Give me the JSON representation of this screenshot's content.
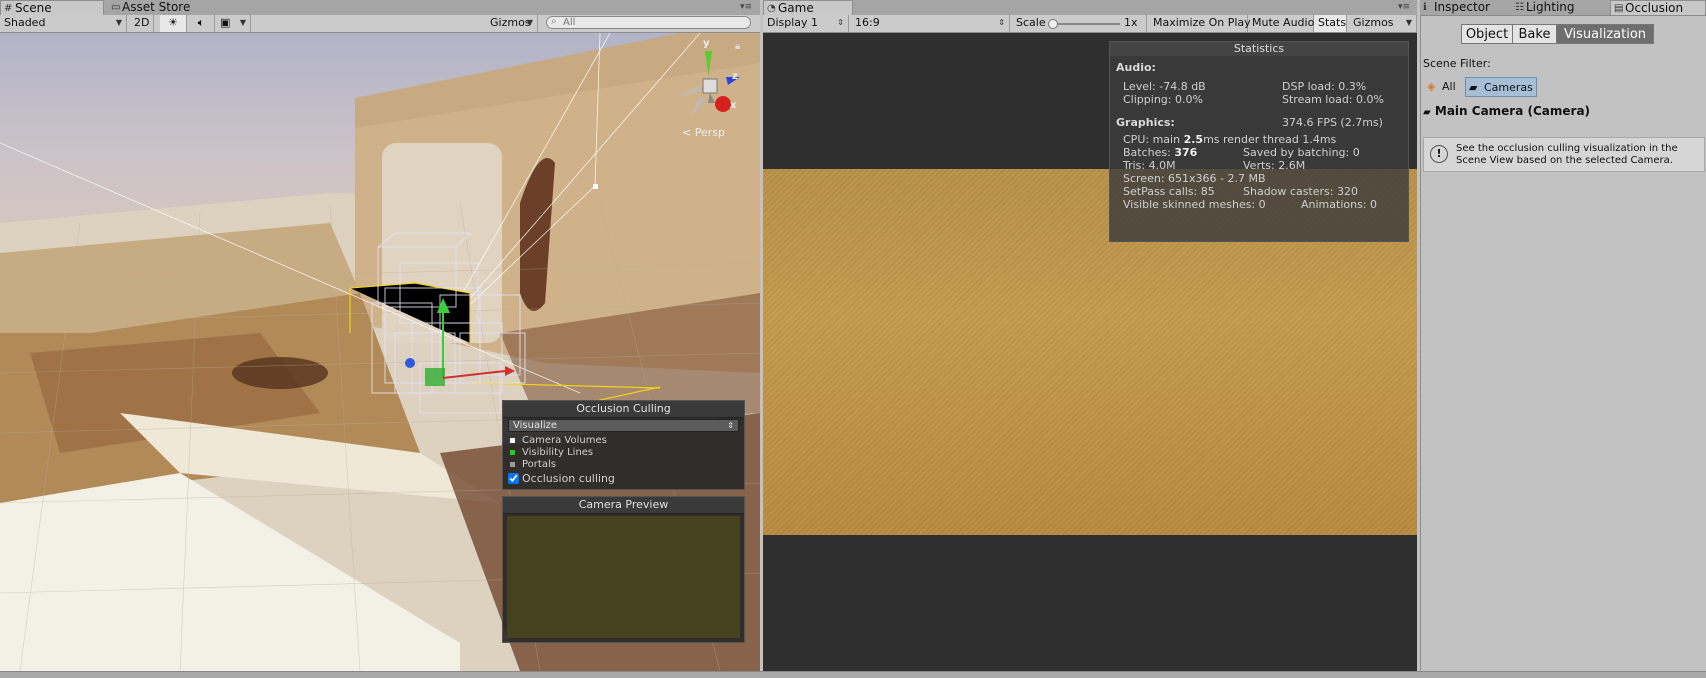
{
  "scene_tabs": {
    "scene": "Scene",
    "asset_store": "Asset Store"
  },
  "scene_toolbar": {
    "draw_mode": "Shaded",
    "mode_2d": "2D",
    "gizmos": "Gizmos",
    "search_placeholder": "All"
  },
  "scene_view": {
    "axis_y": "y",
    "axis_z": "z",
    "axis_x": "x",
    "projection": "Persp",
    "occlusion_panel": {
      "title": "Occlusion Culling",
      "mode": "Visualize",
      "legend": [
        {
          "label": "Camera Volumes",
          "color": "#ffffff"
        },
        {
          "label": "Visibility Lines",
          "color": "#1ed01e"
        },
        {
          "label": "Portals",
          "color": "#9a9a9a"
        }
      ],
      "checkbox_label": "Occlusion culling",
      "checked": true
    },
    "camera_preview": {
      "title": "Camera Preview"
    }
  },
  "game_tabs": {
    "game": "Game"
  },
  "game_toolbar": {
    "display": "Display 1",
    "aspect": "16:9",
    "scale_label": "Scale",
    "scale_value": "1x",
    "maximize": "Maximize On Play",
    "mute": "Mute Audio",
    "stats": "Stats",
    "gizmos": "Gizmos"
  },
  "statistics": {
    "title": "Statistics",
    "audio_heading": "Audio:",
    "level": "Level: -74.8 dB",
    "dsp_load": "DSP load: 0.3%",
    "clipping": "Clipping: 0.0%",
    "stream_load": "Stream load: 0.0%",
    "graphics_heading": "Graphics:",
    "fps": "374.6 FPS (2.7ms)",
    "cpu_prefix": "CPU: main ",
    "cpu_main": "2.5",
    "cpu_suffix": "ms  render thread 1.4ms",
    "batches_prefix": "Batches: ",
    "batches": "376",
    "saved_batching": "Saved by batching: 0",
    "tris": "Tris: 4.0M",
    "verts": "Verts: 2.6M",
    "screen": "Screen: 651x366 - 2.7 MB",
    "setpass": "SetPass calls: 85",
    "shadow_casters": "Shadow casters: 320",
    "skinned": "Visible skinned meshes: 0",
    "animations": "Animations: 0"
  },
  "inspector_tabs": {
    "inspector": "Inspector",
    "lighting": "Lighting",
    "occlusion": "Occlusion"
  },
  "occlusion_window": {
    "segments": [
      "Object",
      "Bake",
      "Visualization"
    ],
    "active_segment": "Visualization",
    "scene_filter_label": "Scene Filter:",
    "filter_all": "All",
    "filter_cameras": "Cameras",
    "camera_title": "Main Camera (Camera)",
    "help_line1": "See the occlusion culling visualization in the",
    "help_line2": "Scene View based on the selected Camera."
  },
  "colors": {
    "toolbar_bg": "#cbcbcb",
    "tab_bar_bg": "#a5a5a5",
    "selected_segment": "#6e6e6e",
    "camera_filter_highlight": "#a7bfd6"
  }
}
